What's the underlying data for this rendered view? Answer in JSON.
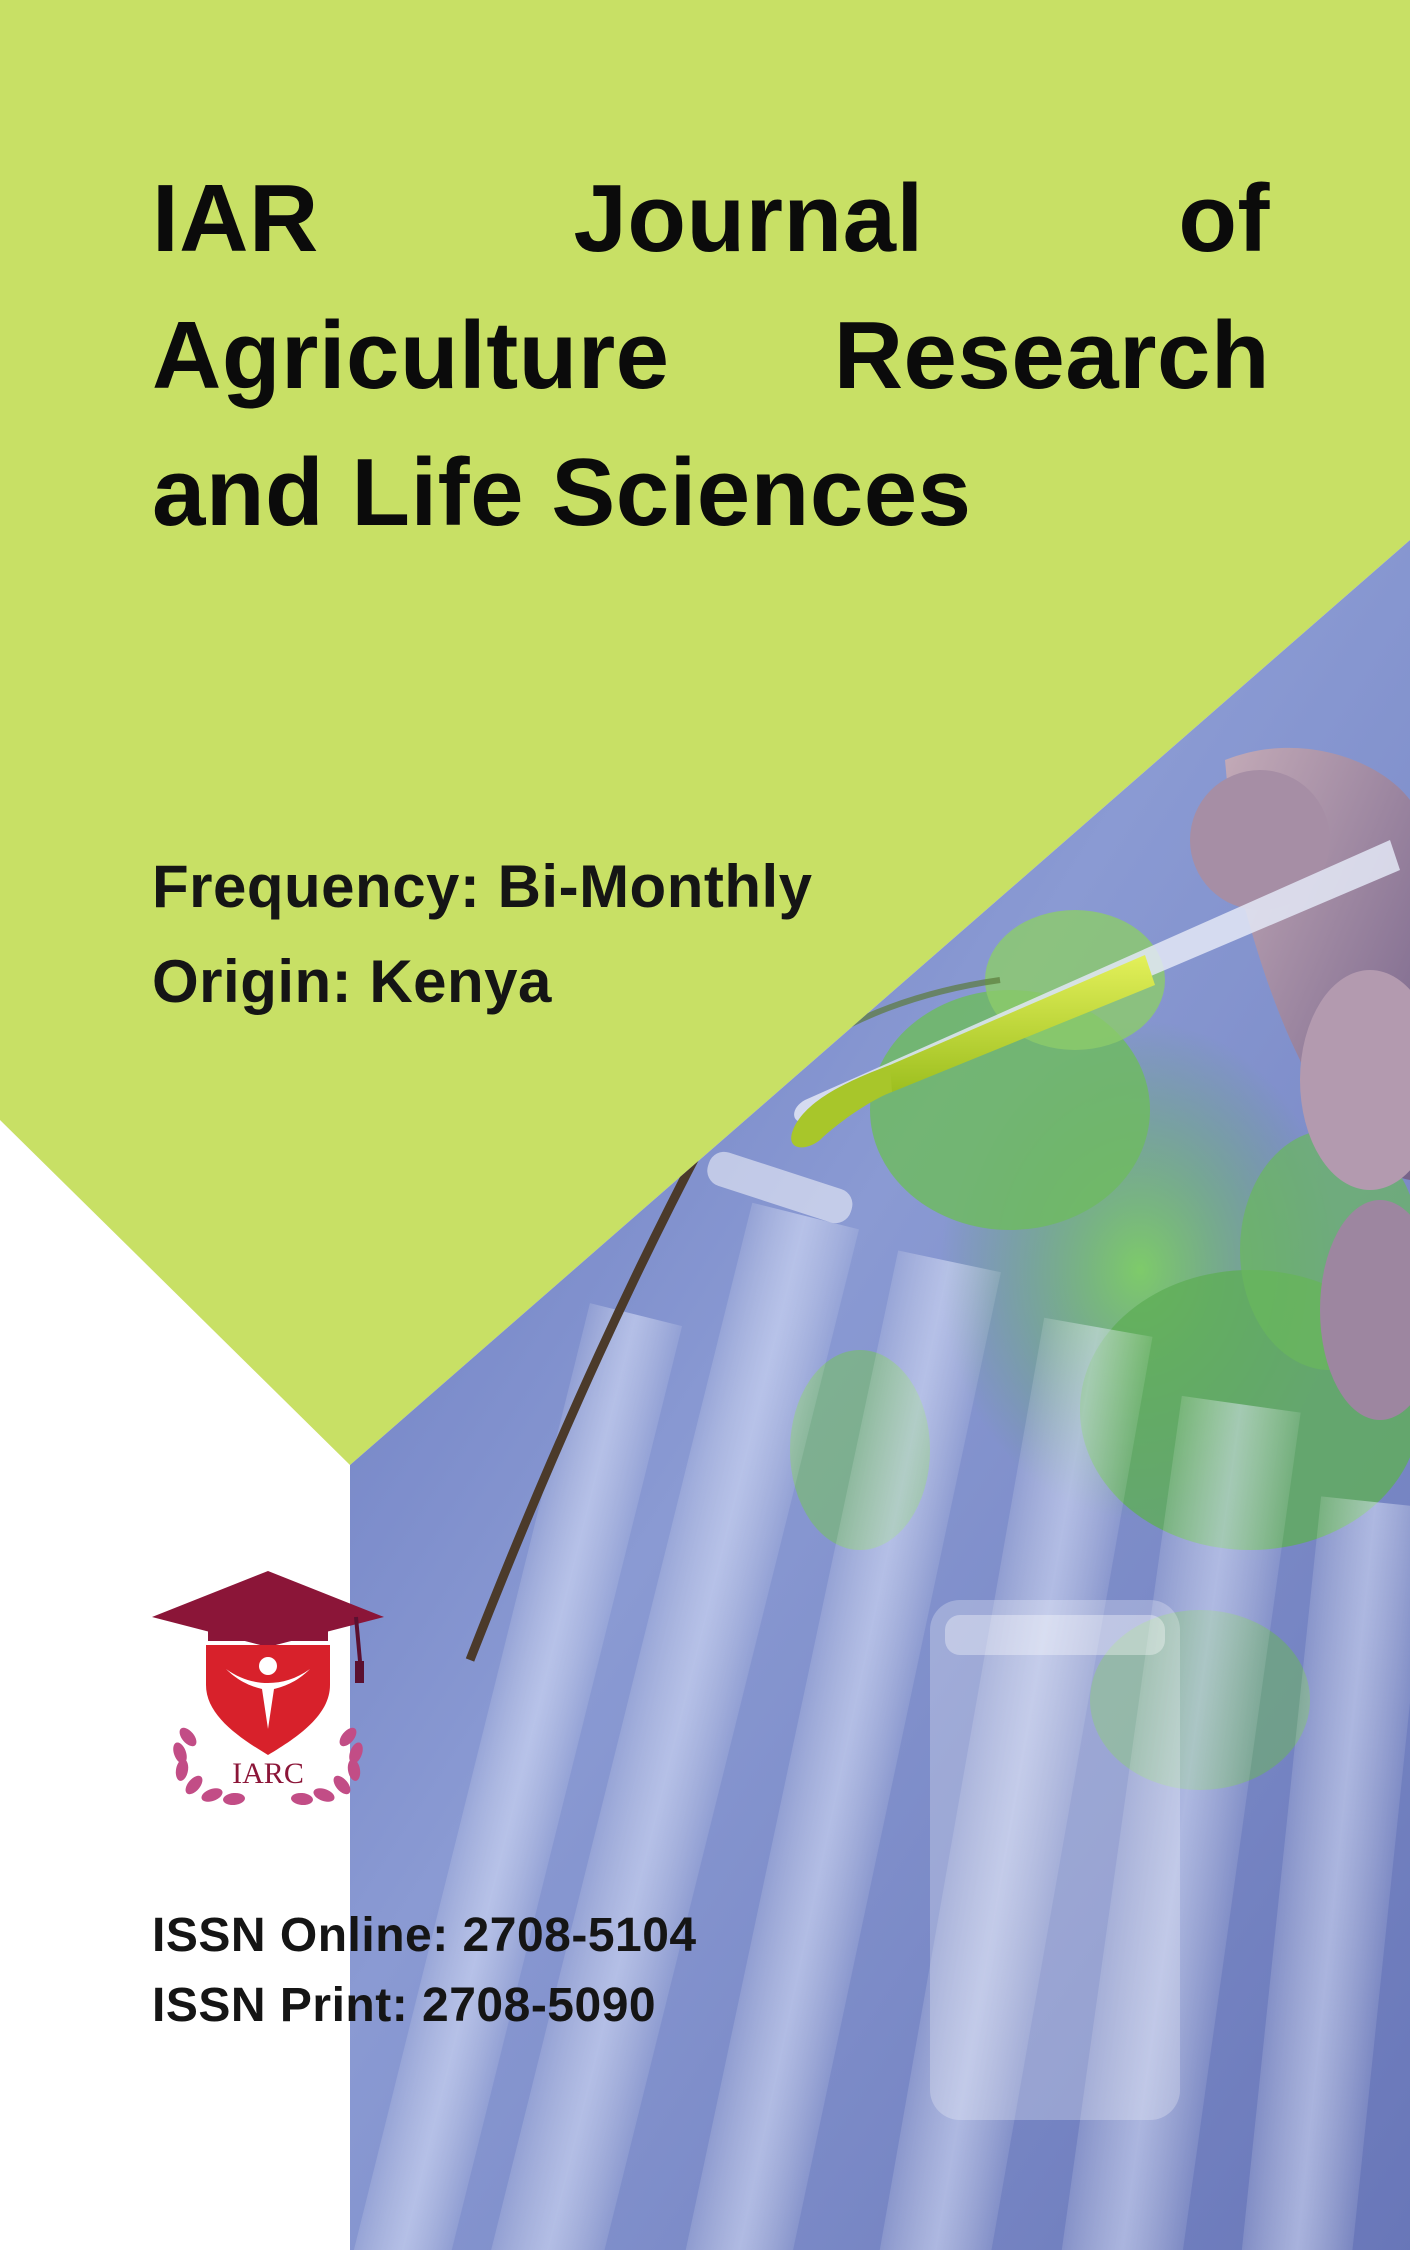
{
  "cover": {
    "title": "IAR Journal of Agriculture Research and Life Sciences",
    "frequency_label": "Frequency:",
    "frequency_value": "Bi-Monthly",
    "origin_label": "Origin:",
    "origin_value": "Kenya",
    "issn_online_label": "ISSN Online:",
    "issn_online_value": "2708-5104",
    "issn_print_label": "ISSN Print:",
    "issn_print_value": "2708-5090"
  },
  "logo": {
    "text": "IARC",
    "icon": "graduation-cap-logo-icon"
  },
  "photo": {
    "icon": "lab-pipette-test-tubes-photo"
  },
  "colors": {
    "lime_panel": "#c8e065",
    "white_panel": "#ffffff",
    "logo_maroon": "#8b1538",
    "logo_red": "#d8212b",
    "logo_laurel": "#c24d86",
    "text": "#0b0b0b"
  }
}
